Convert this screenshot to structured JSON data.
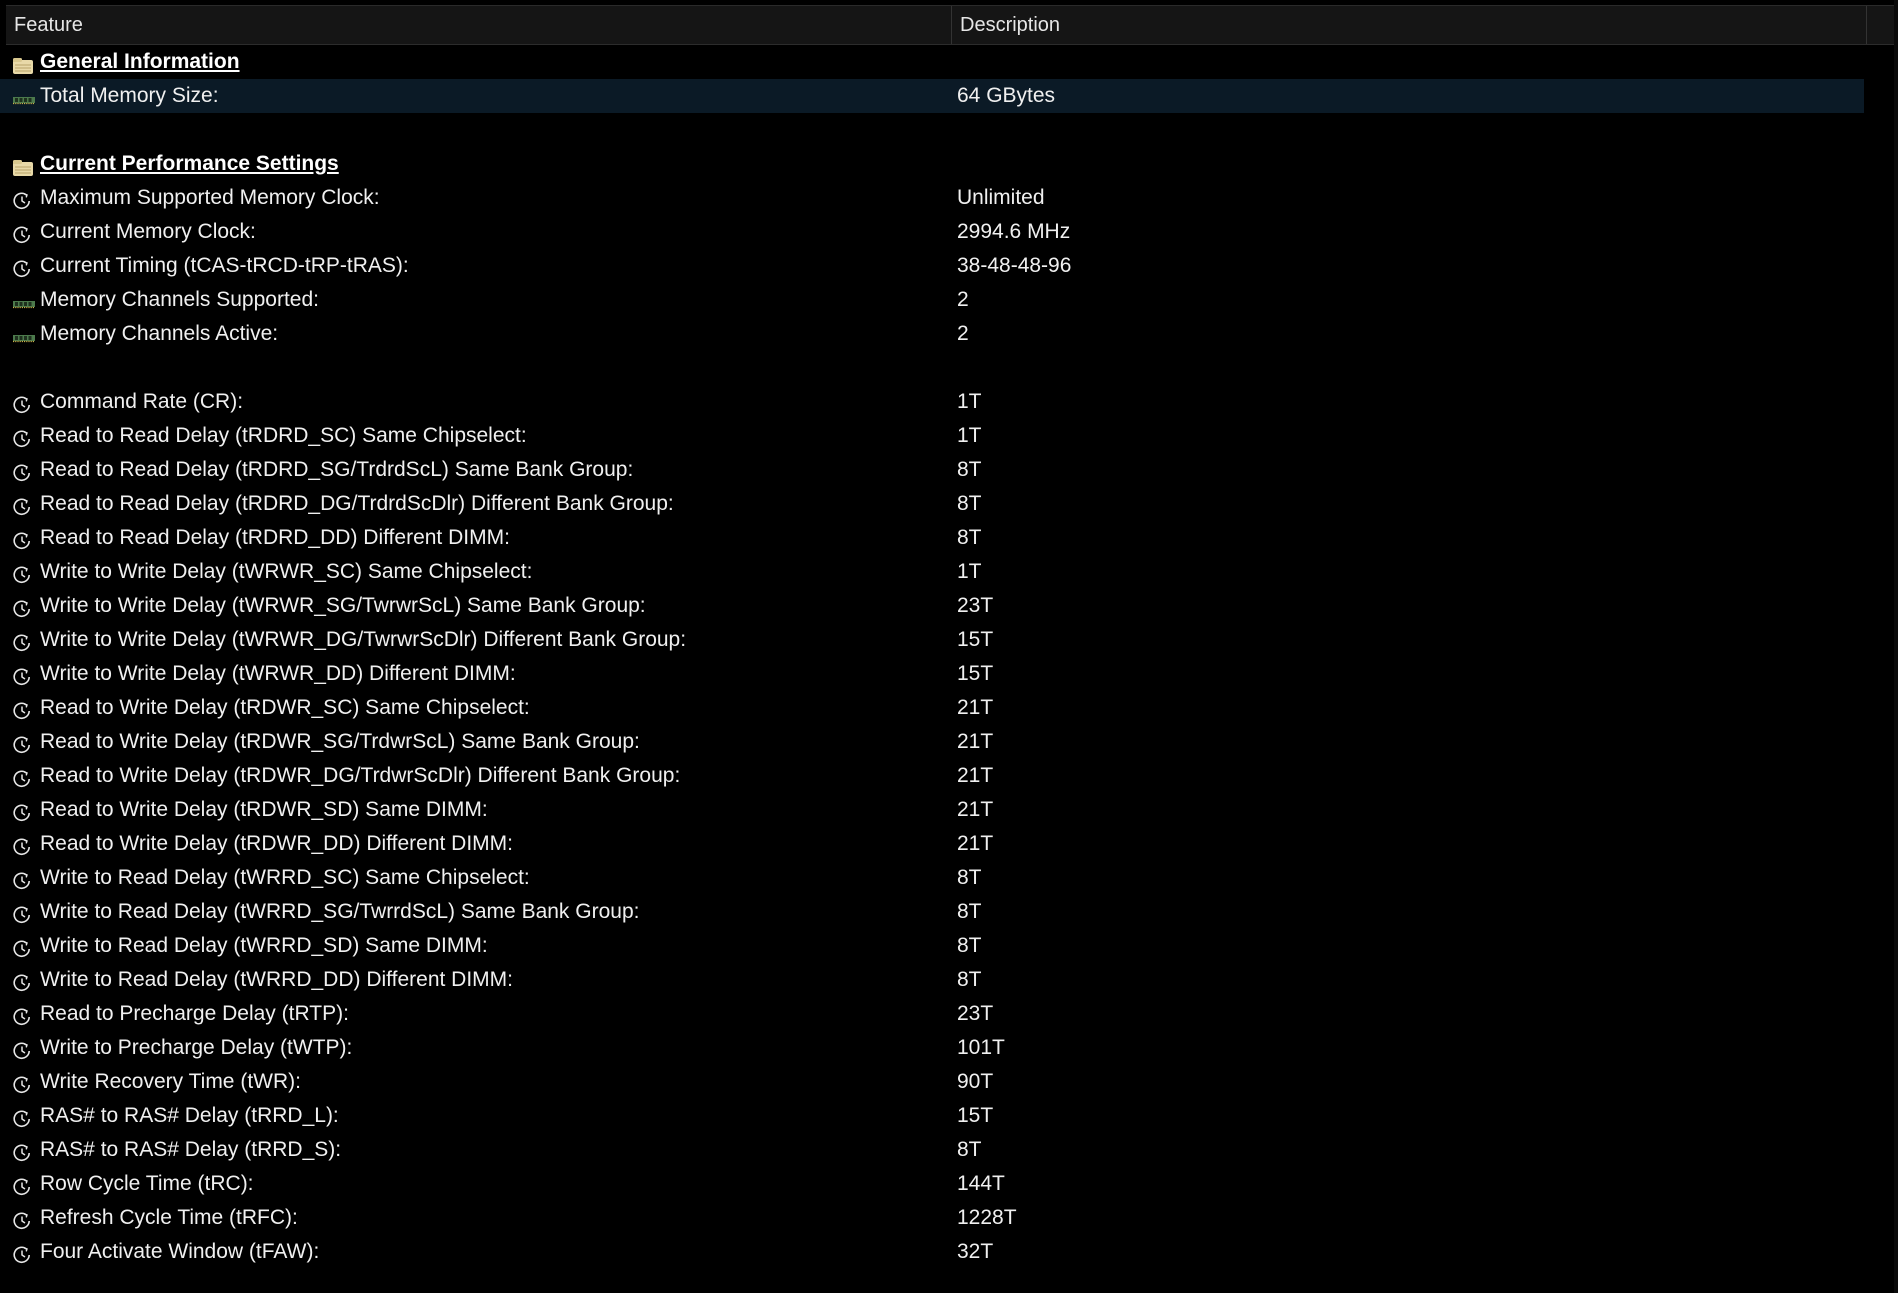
{
  "columns": {
    "feature": "Feature",
    "description": "Description"
  },
  "rows": [
    {
      "kind": "group",
      "icon": "folder-icon",
      "feature": "General Information",
      "value": ""
    },
    {
      "kind": "item",
      "icon": "memory-module-icon",
      "feature": "Total Memory Size:",
      "value": "64 GBytes",
      "selected": true
    },
    {
      "kind": "blank"
    },
    {
      "kind": "group",
      "icon": "folder-icon",
      "feature": "Current Performance Settings",
      "value": ""
    },
    {
      "kind": "item",
      "icon": "clock-icon",
      "feature": "Maximum Supported Memory Clock:",
      "value": "Unlimited"
    },
    {
      "kind": "item",
      "icon": "clock-icon",
      "feature": "Current Memory Clock:",
      "value": "2994.6 MHz"
    },
    {
      "kind": "item",
      "icon": "clock-icon",
      "feature": "Current Timing (tCAS-tRCD-tRP-tRAS):",
      "value": "38-48-48-96"
    },
    {
      "kind": "item",
      "icon": "memory-module-icon",
      "feature": "Memory Channels Supported:",
      "value": "2"
    },
    {
      "kind": "item",
      "icon": "memory-module-icon",
      "feature": "Memory Channels Active:",
      "value": "2"
    },
    {
      "kind": "blank"
    },
    {
      "kind": "item",
      "icon": "clock-icon",
      "feature": "Command Rate (CR):",
      "value": "1T"
    },
    {
      "kind": "item",
      "icon": "clock-icon",
      "feature": "Read to Read Delay (tRDRD_SC) Same Chipselect:",
      "value": "1T"
    },
    {
      "kind": "item",
      "icon": "clock-icon",
      "feature": "Read to Read Delay (tRDRD_SG/TrdrdScL) Same Bank Group:",
      "value": "8T"
    },
    {
      "kind": "item",
      "icon": "clock-icon",
      "feature": "Read to Read Delay (tRDRD_DG/TrdrdScDlr) Different Bank Group:",
      "value": "8T"
    },
    {
      "kind": "item",
      "icon": "clock-icon",
      "feature": "Read to Read Delay (tRDRD_DD) Different DIMM:",
      "value": "8T"
    },
    {
      "kind": "item",
      "icon": "clock-icon",
      "feature": "Write to Write Delay (tWRWR_SC) Same Chipselect:",
      "value": "1T"
    },
    {
      "kind": "item",
      "icon": "clock-icon",
      "feature": "Write to Write Delay (tWRWR_SG/TwrwrScL) Same Bank Group:",
      "value": "23T"
    },
    {
      "kind": "item",
      "icon": "clock-icon",
      "feature": "Write to Write Delay (tWRWR_DG/TwrwrScDlr) Different Bank Group:",
      "value": "15T"
    },
    {
      "kind": "item",
      "icon": "clock-icon",
      "feature": "Write to Write Delay (tWRWR_DD) Different DIMM:",
      "value": "15T"
    },
    {
      "kind": "item",
      "icon": "clock-icon",
      "feature": "Read to Write Delay (tRDWR_SC) Same Chipselect:",
      "value": "21T"
    },
    {
      "kind": "item",
      "icon": "clock-icon",
      "feature": "Read to Write Delay (tRDWR_SG/TrdwrScL) Same Bank Group:",
      "value": "21T"
    },
    {
      "kind": "item",
      "icon": "clock-icon",
      "feature": "Read to Write Delay (tRDWR_DG/TrdwrScDlr) Different Bank Group:",
      "value": "21T"
    },
    {
      "kind": "item",
      "icon": "clock-icon",
      "feature": "Read to Write Delay (tRDWR_SD) Same DIMM:",
      "value": "21T"
    },
    {
      "kind": "item",
      "icon": "clock-icon",
      "feature": "Read to Write Delay (tRDWR_DD) Different DIMM:",
      "value": "21T"
    },
    {
      "kind": "item",
      "icon": "clock-icon",
      "feature": "Write to Read Delay (tWRRD_SC) Same Chipselect:",
      "value": "8T"
    },
    {
      "kind": "item",
      "icon": "clock-icon",
      "feature": "Write to Read Delay (tWRRD_SG/TwrrdScL) Same Bank Group:",
      "value": "8T"
    },
    {
      "kind": "item",
      "icon": "clock-icon",
      "feature": "Write to Read Delay (tWRRD_SD) Same DIMM:",
      "value": "8T"
    },
    {
      "kind": "item",
      "icon": "clock-icon",
      "feature": "Write to Read Delay (tWRRD_DD) Different DIMM:",
      "value": "8T"
    },
    {
      "kind": "item",
      "icon": "clock-icon",
      "feature": "Read to Precharge Delay (tRTP):",
      "value": "23T"
    },
    {
      "kind": "item",
      "icon": "clock-icon",
      "feature": "Write to Precharge Delay (tWTP):",
      "value": "101T"
    },
    {
      "kind": "item",
      "icon": "clock-icon",
      "feature": "Write Recovery Time (tWR):",
      "value": "90T"
    },
    {
      "kind": "item",
      "icon": "clock-icon",
      "feature": "RAS# to RAS# Delay (tRRD_L):",
      "value": "15T"
    },
    {
      "kind": "item",
      "icon": "clock-icon",
      "feature": "RAS# to RAS# Delay (tRRD_S):",
      "value": "8T"
    },
    {
      "kind": "item",
      "icon": "clock-icon",
      "feature": "Row Cycle Time (tRC):",
      "value": "144T"
    },
    {
      "kind": "item",
      "icon": "clock-icon",
      "feature": "Refresh Cycle Time (tRFC):",
      "value": "1228T"
    },
    {
      "kind": "item",
      "icon": "clock-icon",
      "feature": "Four Activate Window (tFAW):",
      "value": "32T"
    }
  ],
  "colors": {
    "background": "#000000",
    "header": "#151515",
    "selected_row": "#0b1a26",
    "text": "#f0f0f0"
  }
}
